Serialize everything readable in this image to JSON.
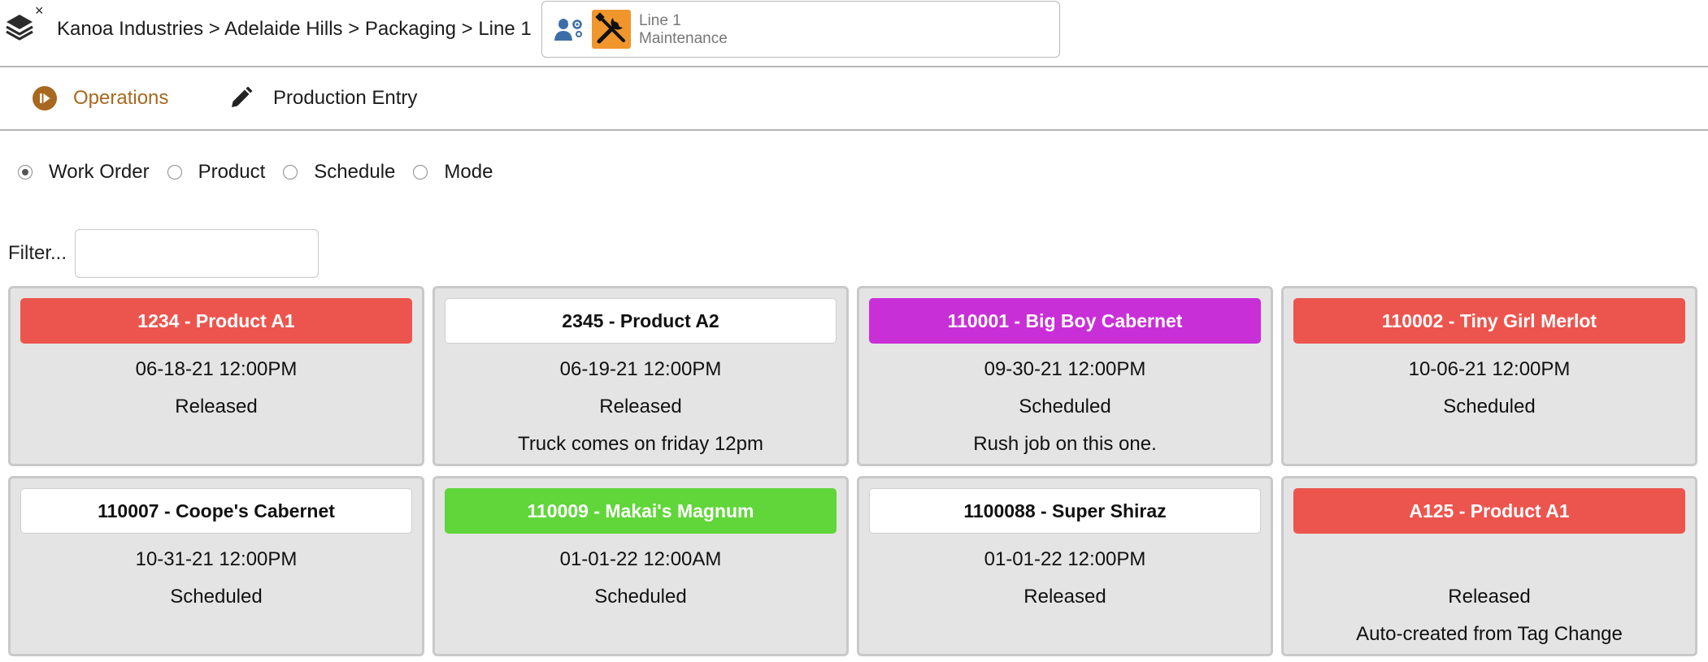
{
  "header": {
    "breadcrumb": "Kanoa Industries > Adelaide Hills > Packaging > Line 1",
    "context": {
      "line1": "Line 1",
      "line2": "Maintenance"
    },
    "close_glyph": "×"
  },
  "tabs": [
    {
      "label": "Operations",
      "icon": "play-circle-icon",
      "active": true
    },
    {
      "label": "Production Entry",
      "icon": "pencil-icon",
      "active": false
    }
  ],
  "view_mode": {
    "options": [
      "Work Order",
      "Product",
      "Schedule",
      "Mode"
    ],
    "selected": "Work Order"
  },
  "filter": {
    "label": "Filter...",
    "value": "",
    "placeholder": ""
  },
  "colors": {
    "accent": "#a8681f",
    "red": "#ec554e",
    "purple": "#c92fd6",
    "green": "#60d63a",
    "white": "#ffffff",
    "maintenance_orange": "#f0962c",
    "workers_blue": "#3b6ea8"
  },
  "cards": [
    {
      "title": "1234 - Product A1",
      "color": "red",
      "date": "06-18-21 12:00PM",
      "status": "Released",
      "note": ""
    },
    {
      "title": "2345 - Product A2",
      "color": "white",
      "date": "06-19-21 12:00PM",
      "status": "Released",
      "note": "Truck comes on friday 12pm"
    },
    {
      "title": "110001 - Big Boy Cabernet",
      "color": "purple",
      "date": "09-30-21 12:00PM",
      "status": "Scheduled",
      "note": "Rush job on this one."
    },
    {
      "title": "110002 - Tiny Girl Merlot",
      "color": "red",
      "date": "10-06-21 12:00PM",
      "status": "Scheduled",
      "note": ""
    },
    {
      "title": "110007 - Coope's Cabernet",
      "color": "white",
      "date": "10-31-21 12:00PM",
      "status": "Scheduled",
      "note": ""
    },
    {
      "title": "110009 - Makai's Magnum",
      "color": "green",
      "date": "01-01-22 12:00AM",
      "status": "Scheduled",
      "note": ""
    },
    {
      "title": "1100088 - Super Shiraz",
      "color": "white",
      "date": "01-01-22 12:00PM",
      "status": "Released",
      "note": ""
    },
    {
      "title": "A125 - Product A1",
      "color": "red",
      "date": "",
      "status": "Released",
      "note": "Auto-created from Tag Change"
    }
  ]
}
